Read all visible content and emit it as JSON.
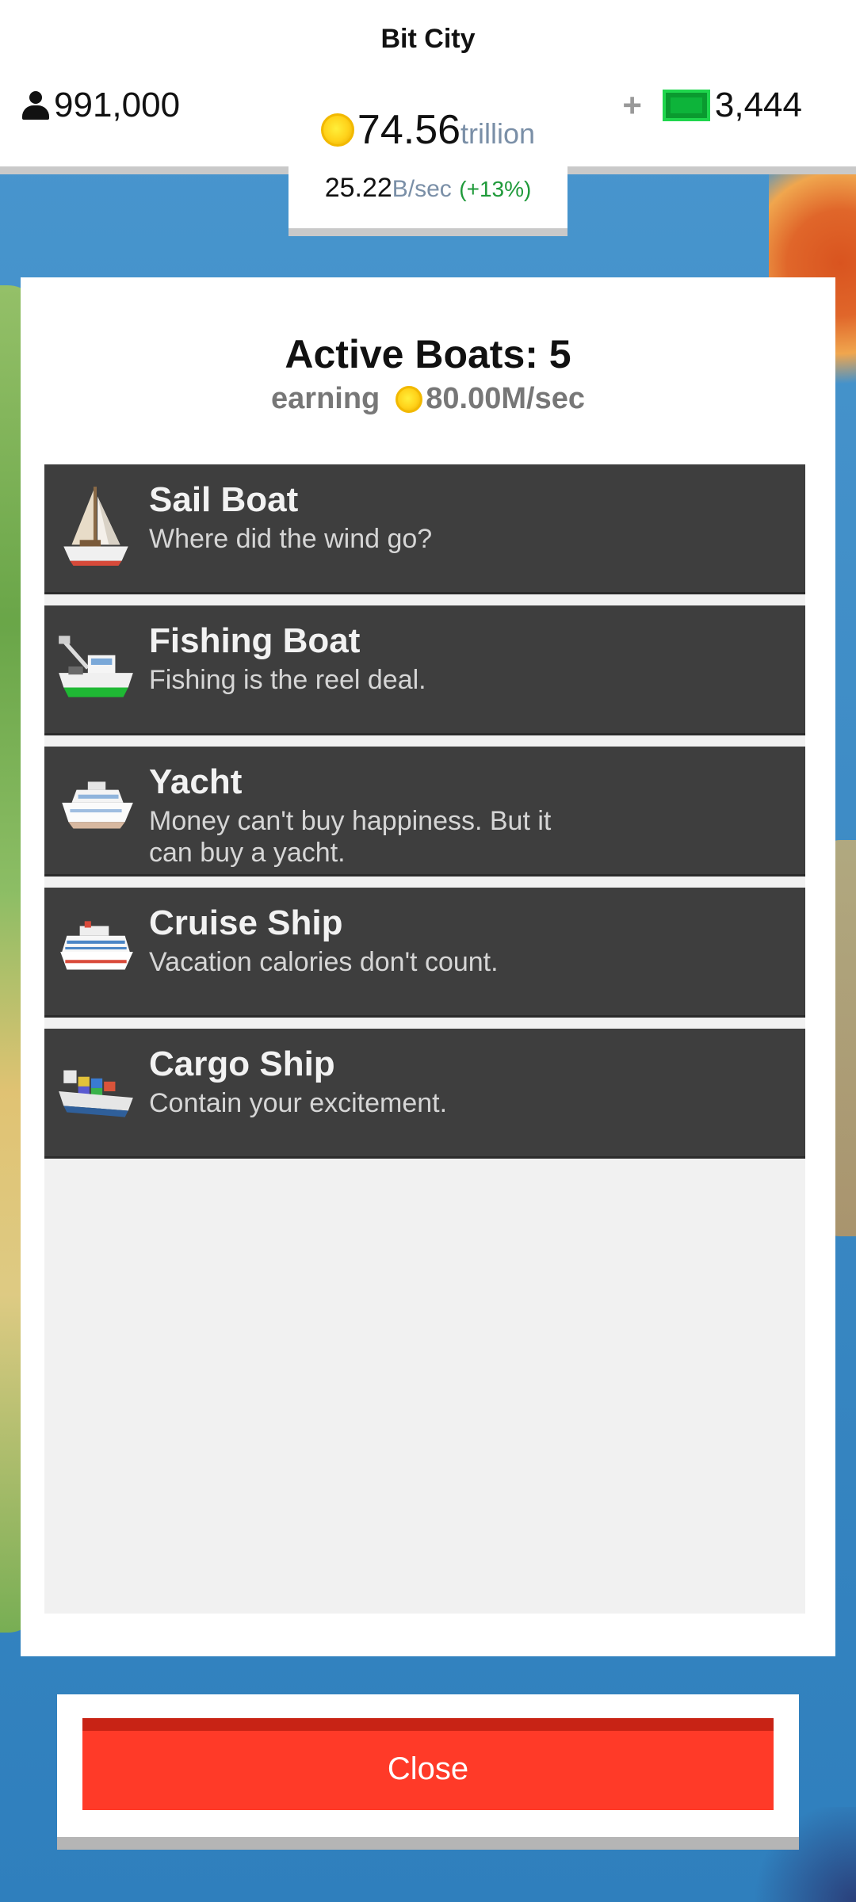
{
  "header": {
    "city_name": "Bit City",
    "population": "991,000",
    "coins_value": "74.56",
    "coins_unit": "trillion",
    "rate_value": "25.22",
    "rate_unit": "B/sec",
    "rate_bonus": "(+13%)",
    "plus_label": "+",
    "cash": "3,444"
  },
  "modal": {
    "title": "Active Boats: 5",
    "earning_label": "earning",
    "earning_value": "80.00M/sec",
    "items": [
      {
        "name": "Sail Boat",
        "desc": "Where did the wind go?",
        "icon": "sail-boat-icon"
      },
      {
        "name": "Fishing Boat",
        "desc": "Fishing is the reel deal.",
        "icon": "fishing-boat-icon"
      },
      {
        "name": "Yacht",
        "desc": "Money can't buy happiness. But it can buy a yacht.",
        "icon": "yacht-icon"
      },
      {
        "name": "Cruise Ship",
        "desc": "Vacation calories don't count.",
        "icon": "cruise-ship-icon"
      },
      {
        "name": "Cargo Ship",
        "desc": "Contain your excitement.",
        "icon": "cargo-ship-icon"
      }
    ],
    "close_label": "Close"
  },
  "colors": {
    "close_button": "#ff3a28",
    "item_background": "#3e3e3e",
    "cash_green": "#0db43a",
    "coin_gold": "#ffd21a",
    "bonus_green": "#1f9a3a"
  }
}
